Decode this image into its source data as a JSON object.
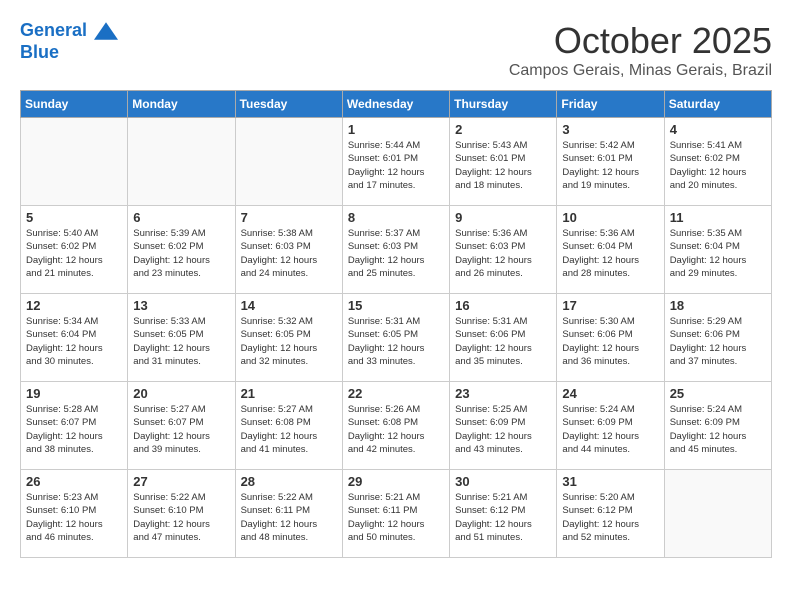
{
  "header": {
    "logo_line1": "General",
    "logo_line2": "Blue",
    "title": "October 2025",
    "subtitle": "Campos Gerais, Minas Gerais, Brazil"
  },
  "days_of_week": [
    "Sunday",
    "Monday",
    "Tuesday",
    "Wednesday",
    "Thursday",
    "Friday",
    "Saturday"
  ],
  "weeks": [
    [
      {
        "day": "",
        "info": ""
      },
      {
        "day": "",
        "info": ""
      },
      {
        "day": "",
        "info": ""
      },
      {
        "day": "1",
        "info": "Sunrise: 5:44 AM\nSunset: 6:01 PM\nDaylight: 12 hours\nand 17 minutes."
      },
      {
        "day": "2",
        "info": "Sunrise: 5:43 AM\nSunset: 6:01 PM\nDaylight: 12 hours\nand 18 minutes."
      },
      {
        "day": "3",
        "info": "Sunrise: 5:42 AM\nSunset: 6:01 PM\nDaylight: 12 hours\nand 19 minutes."
      },
      {
        "day": "4",
        "info": "Sunrise: 5:41 AM\nSunset: 6:02 PM\nDaylight: 12 hours\nand 20 minutes."
      }
    ],
    [
      {
        "day": "5",
        "info": "Sunrise: 5:40 AM\nSunset: 6:02 PM\nDaylight: 12 hours\nand 21 minutes."
      },
      {
        "day": "6",
        "info": "Sunrise: 5:39 AM\nSunset: 6:02 PM\nDaylight: 12 hours\nand 23 minutes."
      },
      {
        "day": "7",
        "info": "Sunrise: 5:38 AM\nSunset: 6:03 PM\nDaylight: 12 hours\nand 24 minutes."
      },
      {
        "day": "8",
        "info": "Sunrise: 5:37 AM\nSunset: 6:03 PM\nDaylight: 12 hours\nand 25 minutes."
      },
      {
        "day": "9",
        "info": "Sunrise: 5:36 AM\nSunset: 6:03 PM\nDaylight: 12 hours\nand 26 minutes."
      },
      {
        "day": "10",
        "info": "Sunrise: 5:36 AM\nSunset: 6:04 PM\nDaylight: 12 hours\nand 28 minutes."
      },
      {
        "day": "11",
        "info": "Sunrise: 5:35 AM\nSunset: 6:04 PM\nDaylight: 12 hours\nand 29 minutes."
      }
    ],
    [
      {
        "day": "12",
        "info": "Sunrise: 5:34 AM\nSunset: 6:04 PM\nDaylight: 12 hours\nand 30 minutes."
      },
      {
        "day": "13",
        "info": "Sunrise: 5:33 AM\nSunset: 6:05 PM\nDaylight: 12 hours\nand 31 minutes."
      },
      {
        "day": "14",
        "info": "Sunrise: 5:32 AM\nSunset: 6:05 PM\nDaylight: 12 hours\nand 32 minutes."
      },
      {
        "day": "15",
        "info": "Sunrise: 5:31 AM\nSunset: 6:05 PM\nDaylight: 12 hours\nand 33 minutes."
      },
      {
        "day": "16",
        "info": "Sunrise: 5:31 AM\nSunset: 6:06 PM\nDaylight: 12 hours\nand 35 minutes."
      },
      {
        "day": "17",
        "info": "Sunrise: 5:30 AM\nSunset: 6:06 PM\nDaylight: 12 hours\nand 36 minutes."
      },
      {
        "day": "18",
        "info": "Sunrise: 5:29 AM\nSunset: 6:06 PM\nDaylight: 12 hours\nand 37 minutes."
      }
    ],
    [
      {
        "day": "19",
        "info": "Sunrise: 5:28 AM\nSunset: 6:07 PM\nDaylight: 12 hours\nand 38 minutes."
      },
      {
        "day": "20",
        "info": "Sunrise: 5:27 AM\nSunset: 6:07 PM\nDaylight: 12 hours\nand 39 minutes."
      },
      {
        "day": "21",
        "info": "Sunrise: 5:27 AM\nSunset: 6:08 PM\nDaylight: 12 hours\nand 41 minutes."
      },
      {
        "day": "22",
        "info": "Sunrise: 5:26 AM\nSunset: 6:08 PM\nDaylight: 12 hours\nand 42 minutes."
      },
      {
        "day": "23",
        "info": "Sunrise: 5:25 AM\nSunset: 6:09 PM\nDaylight: 12 hours\nand 43 minutes."
      },
      {
        "day": "24",
        "info": "Sunrise: 5:24 AM\nSunset: 6:09 PM\nDaylight: 12 hours\nand 44 minutes."
      },
      {
        "day": "25",
        "info": "Sunrise: 5:24 AM\nSunset: 6:09 PM\nDaylight: 12 hours\nand 45 minutes."
      }
    ],
    [
      {
        "day": "26",
        "info": "Sunrise: 5:23 AM\nSunset: 6:10 PM\nDaylight: 12 hours\nand 46 minutes."
      },
      {
        "day": "27",
        "info": "Sunrise: 5:22 AM\nSunset: 6:10 PM\nDaylight: 12 hours\nand 47 minutes."
      },
      {
        "day": "28",
        "info": "Sunrise: 5:22 AM\nSunset: 6:11 PM\nDaylight: 12 hours\nand 48 minutes."
      },
      {
        "day": "29",
        "info": "Sunrise: 5:21 AM\nSunset: 6:11 PM\nDaylight: 12 hours\nand 50 minutes."
      },
      {
        "day": "30",
        "info": "Sunrise: 5:21 AM\nSunset: 6:12 PM\nDaylight: 12 hours\nand 51 minutes."
      },
      {
        "day": "31",
        "info": "Sunrise: 5:20 AM\nSunset: 6:12 PM\nDaylight: 12 hours\nand 52 minutes."
      },
      {
        "day": "",
        "info": ""
      }
    ]
  ]
}
